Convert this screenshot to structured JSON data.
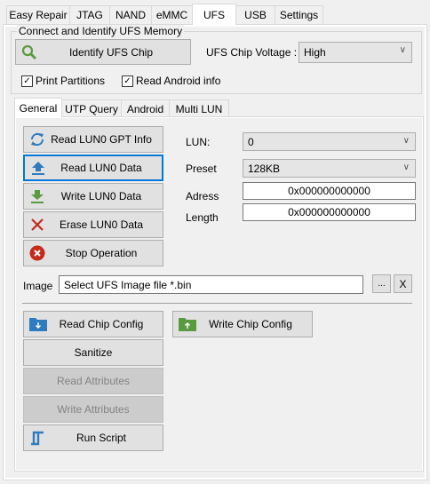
{
  "main_tabs": [
    "Easy Repair",
    "JTAG",
    "NAND",
    "eMMC",
    "UFS",
    "USB",
    "Settings"
  ],
  "active_main_tab": "UFS",
  "group": {
    "title": "Connect and Identify UFS Memory",
    "identify_button": "Identify UFS Chip",
    "voltage_label": "UFS Chip Voltage :",
    "voltage_value": "High",
    "print_partitions": {
      "label": "Print Partitions",
      "checked": true
    },
    "read_android_info": {
      "label": "Read Android info",
      "checked": true
    }
  },
  "sub_tabs": [
    "General",
    "UTP Query",
    "Android",
    "Multi LUN"
  ],
  "active_sub_tab": "General",
  "general": {
    "buttons": {
      "read_gpt": "Read LUN0 GPT Info",
      "read_data": "Read LUN0 Data",
      "write_data": "Write LUN0 Data",
      "erase_data": "Erase LUN0 Data",
      "stop": "Stop Operation"
    },
    "lun_label": "LUN:",
    "lun_value": "0",
    "preset_label": "Preset",
    "preset_value": "128KB",
    "address_label": "Adress",
    "address_value": "0x000000000000",
    "length_label": "Length",
    "length_value": "0x000000000000",
    "image_label": "Image",
    "image_placeholder": "Select UFS Image file *.bin",
    "browse_button": "...",
    "clear_button": "X",
    "read_config": "Read Chip Config",
    "write_config": "Write Chip Config",
    "sanitize": "Sanitize",
    "read_attributes": "Read Attributes",
    "write_attributes": "Write Attributes",
    "run_script": "Run Script"
  },
  "colors": {
    "focus": "#0078d7",
    "blue_icon": "#2e7bbf",
    "green_icon": "#5a9b3f",
    "red_icon": "#c42b1c"
  }
}
